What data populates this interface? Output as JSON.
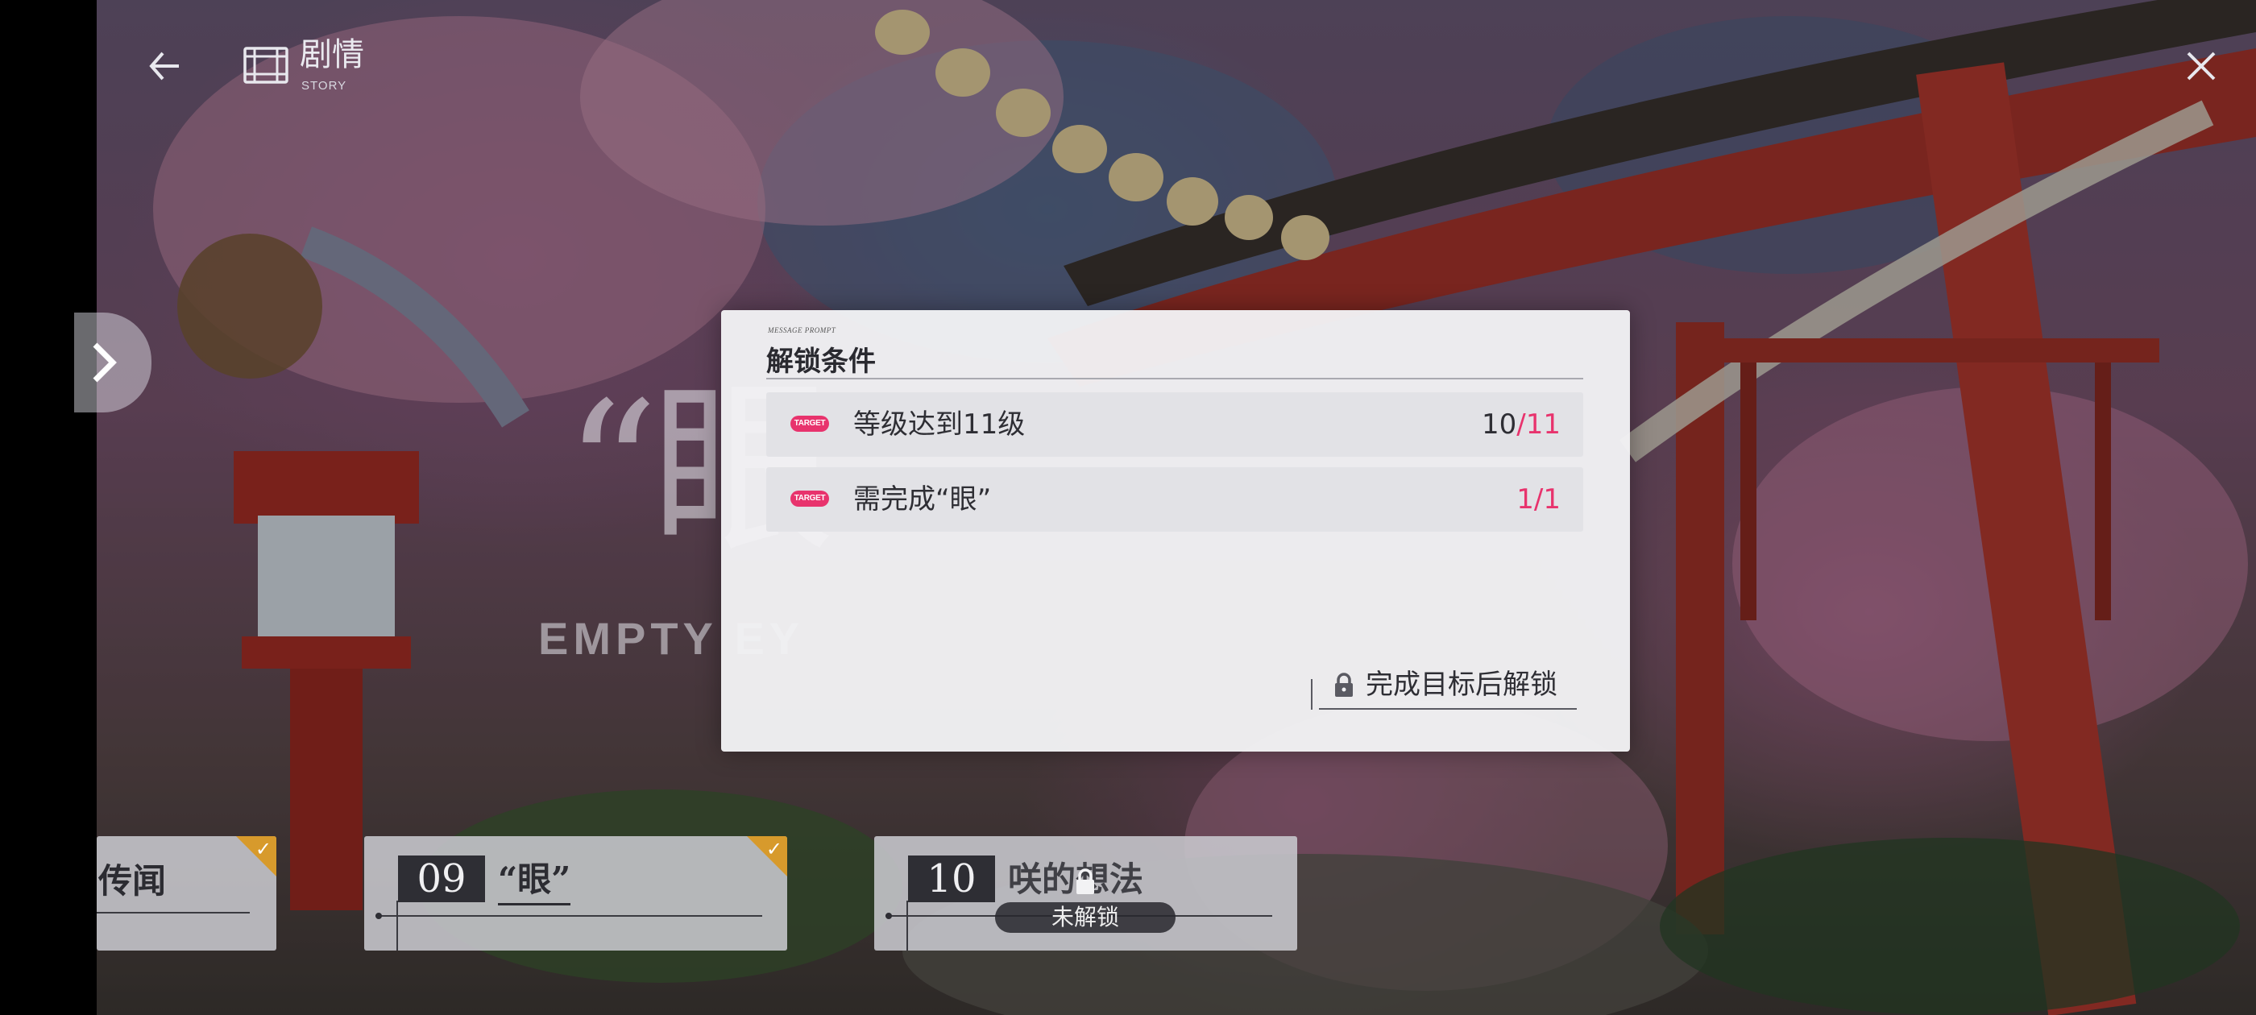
{
  "header": {
    "back_icon": "arrow-left-icon",
    "story_icon": "film-icon",
    "title": "剧情",
    "subtitle": "STORY",
    "close_icon": "close-icon"
  },
  "background": {
    "big_glyph": "“眼",
    "sub_text": "EMPTY EY"
  },
  "modal": {
    "eyebrow": "MESSAGE PROMPT",
    "title": "解锁条件",
    "conditions": [
      {
        "tag": "TARGET",
        "text": "等级达到11级",
        "current": "10",
        "separator": "/",
        "max": "11"
      },
      {
        "tag": "TARGET",
        "text": "需完成“眼”",
        "current": "1",
        "separator": "/",
        "max": "1"
      }
    ],
    "unlock_hint": "完成目标后解锁"
  },
  "chapters": [
    {
      "title": "传闻",
      "completed": true
    },
    {
      "number": "09",
      "title": "“眼”",
      "completed": true
    },
    {
      "number": "10",
      "title": "咲的想法",
      "status": "未解锁",
      "completed": false
    }
  ],
  "colors": {
    "accent": "#e8336d",
    "complete_badge": "#d79a2c"
  }
}
